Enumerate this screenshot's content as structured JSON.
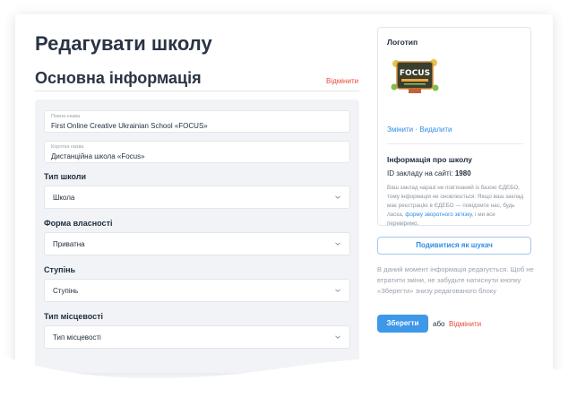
{
  "page": {
    "title": "Редагувати школу",
    "section_title": "Основна інформація",
    "cancel_label": "Відмінити"
  },
  "form": {
    "full_name": {
      "label": "Повна назва",
      "value": "First Online Creative Ukrainian School «FOCUS»"
    },
    "short_name": {
      "label": "Коротка назва",
      "value": "Дистанційна школа «Focus»"
    },
    "school_type": {
      "label": "Тип школи",
      "value": "Школа"
    },
    "ownership": {
      "label": "Форма власності",
      "value": "Приватна"
    },
    "level": {
      "label": "Ступінь",
      "value": "Ступінь"
    },
    "locality": {
      "label": "Тип місцевості",
      "value": "Тип місцевості"
    }
  },
  "sidebar": {
    "logo_heading": "Логотип",
    "logo_text": "FOCUS",
    "change_label": "Змінити",
    "separator": "·",
    "delete_label": "Видалити",
    "info_heading": "Інформація про школу",
    "site_id_label": "ID закладу на сайті:",
    "site_id_value": "1980",
    "note_text": "Ваш заклад наразі не пов'язаний із базою ЄДЕБО, тому інформація не оновлюється. Якщо ваш заклад має реєстрацію в ЄДЕБО — повідомте нас, будь ласка,",
    "note_link": "форму зворотного зв'язку",
    "note_tail": ", і ми все перевіримо."
  },
  "actions": {
    "preview_label": "Подивитися як шукач",
    "edit_note": "В даний момент інформація редагується. Щоб не втратити зміни, не забудьте натиснути кнопку «Зберегти» знизу редагованого блоку",
    "save_label": "Зберегти",
    "or_label": "або",
    "cancel_label": "Відмінити"
  },
  "colors": {
    "accent_blue": "#3d98ea",
    "link_blue": "#2f8be6",
    "cancel_red": "#e8493a",
    "panel_bg": "#f1f3f6"
  }
}
